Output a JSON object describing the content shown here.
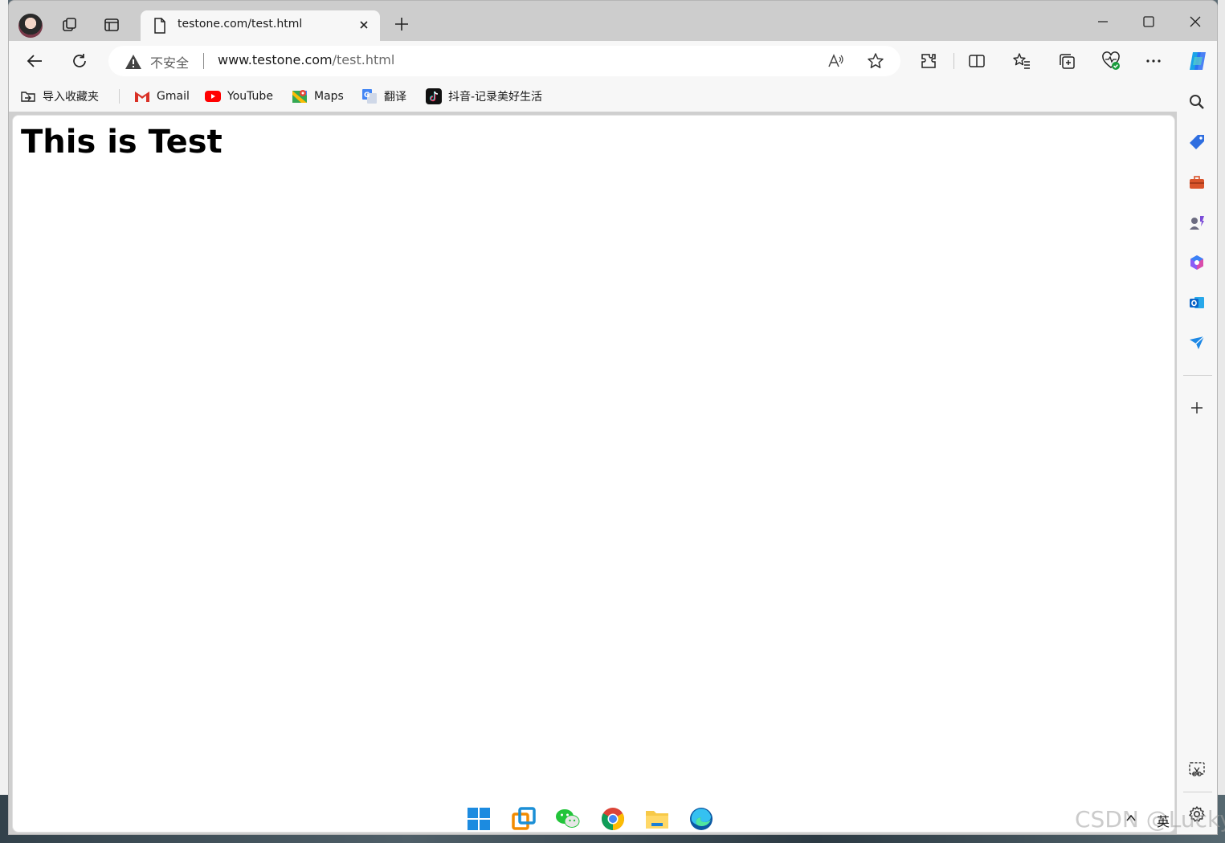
{
  "tab": {
    "title": "testone.com/test.html"
  },
  "address": {
    "security_label": "不安全",
    "url_host": "www.testone.com",
    "url_path": "/test.html"
  },
  "bookmarks": [
    {
      "label": "导入收藏夹",
      "icon": "import-favorites-icon"
    },
    {
      "label": "Gmail",
      "icon": "gmail-icon"
    },
    {
      "label": "YouTube",
      "icon": "youtube-icon"
    },
    {
      "label": "Maps",
      "icon": "maps-icon"
    },
    {
      "label": "翻译",
      "icon": "translate-icon"
    },
    {
      "label": "抖音-记录美好生活",
      "icon": "tiktok-icon"
    }
  ],
  "page": {
    "heading": "This is Test"
  },
  "taskbar": {
    "ime": "英"
  },
  "watermark": "CSDN @Lucky",
  "colors": {
    "accent": "#0078d4",
    "youtube": "#ff0000",
    "gmail": "#d93025"
  }
}
